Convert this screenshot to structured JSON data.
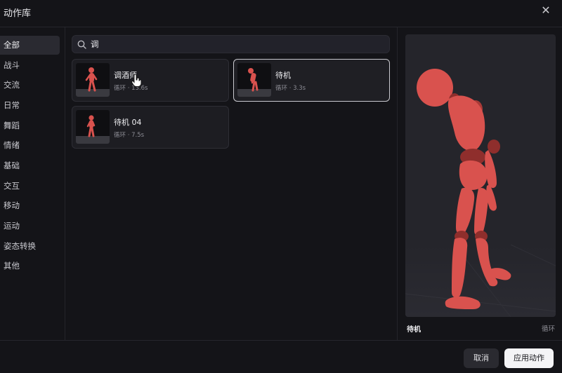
{
  "dialog": {
    "title": "动作库"
  },
  "categories": [
    "全部",
    "战斗",
    "交流",
    "日常",
    "舞蹈",
    "情绪",
    "基础",
    "交互",
    "移动",
    "运动",
    "姿态转换",
    "其他"
  ],
  "search": {
    "value": "调"
  },
  "results": [
    {
      "name": "调酒师",
      "meta": "循环 · 13.6s"
    },
    {
      "name": "待机",
      "meta": "循环 · 3.3s"
    },
    {
      "name": "待机 04",
      "meta": "循环 · 7.5s"
    }
  ],
  "preview": {
    "name": "待机",
    "loop": "循环"
  },
  "footer": {
    "cancel": "取消",
    "apply": "应用动作"
  },
  "colors": {
    "figure": "#d9524e",
    "figure_shadow": "#8f2e2c",
    "accent": "#f4f4f6"
  }
}
